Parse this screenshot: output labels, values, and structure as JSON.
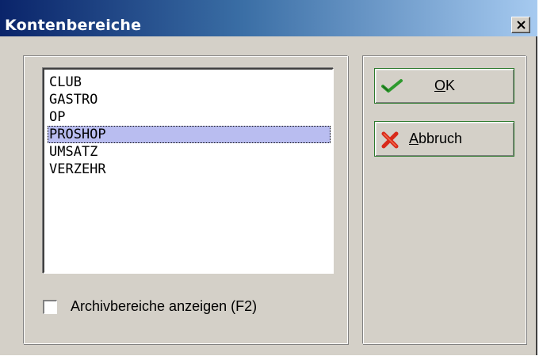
{
  "window": {
    "title": "Kontenbereiche",
    "close_label": "×"
  },
  "list": {
    "items": [
      "CLUB",
      "GASTRO",
      "OP",
      "PROSHOP",
      "UMSATZ",
      "VERZEHR"
    ],
    "selected": "PROSHOP"
  },
  "checkbox": {
    "label": "Archivbereiche anzeigen (F2)",
    "checked": false
  },
  "buttons": {
    "ok": {
      "accel": "O",
      "rest": "K",
      "icon": "checkmark-icon"
    },
    "cancel": {
      "accel": "A",
      "rest": "bbruch",
      "icon": "red-x-icon"
    }
  },
  "colors": {
    "titlebar_start": "#0a246a",
    "titlebar_end": "#a6caf0",
    "selection": "#b9bdf0",
    "ok_icon": "#2e9a2e",
    "cancel_icon": "#d82a1a"
  }
}
